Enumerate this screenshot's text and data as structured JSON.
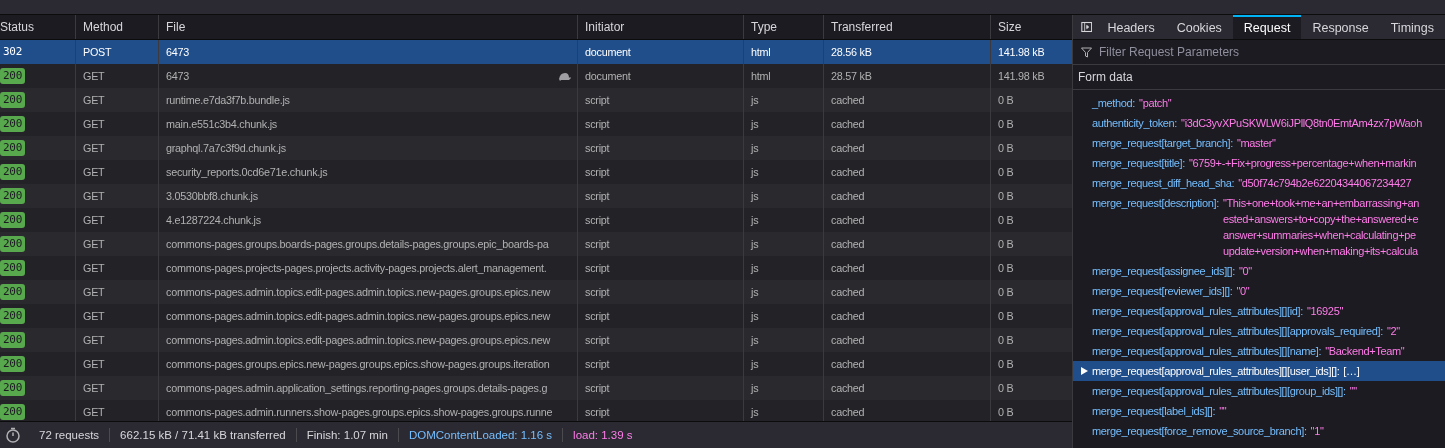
{
  "columns": [
    "Status",
    "Method",
    "File",
    "Initiator",
    "Type",
    "Transferred",
    "Size"
  ],
  "requests": [
    {
      "status": "302",
      "method": "POST",
      "file": "6473",
      "slow": false,
      "initiator": "document",
      "type": "html",
      "transferred": "28.56 kB",
      "size": "141.98 kB",
      "selected": true
    },
    {
      "status": "200",
      "method": "GET",
      "file": "6473",
      "slow": true,
      "initiator": "document",
      "type": "html",
      "transferred": "28.57 kB",
      "size": "141.98 kB",
      "selected": false
    },
    {
      "status": "200",
      "method": "GET",
      "file": "runtime.e7da3f7b.bundle.js",
      "slow": false,
      "initiator": "script",
      "type": "js",
      "transferred": "cached",
      "size": "0 B",
      "selected": false
    },
    {
      "status": "200",
      "method": "GET",
      "file": "main.e551c3b4.chunk.js",
      "slow": false,
      "initiator": "script",
      "type": "js",
      "transferred": "cached",
      "size": "0 B",
      "selected": false
    },
    {
      "status": "200",
      "method": "GET",
      "file": "graphql.7a7c3f9d.chunk.js",
      "slow": false,
      "initiator": "script",
      "type": "js",
      "transferred": "cached",
      "size": "0 B",
      "selected": false
    },
    {
      "status": "200",
      "method": "GET",
      "file": "security_reports.0cd6e71e.chunk.js",
      "slow": false,
      "initiator": "script",
      "type": "js",
      "transferred": "cached",
      "size": "0 B",
      "selected": false
    },
    {
      "status": "200",
      "method": "GET",
      "file": "3.0530bbf8.chunk.js",
      "slow": false,
      "initiator": "script",
      "type": "js",
      "transferred": "cached",
      "size": "0 B",
      "selected": false
    },
    {
      "status": "200",
      "method": "GET",
      "file": "4.e1287224.chunk.js",
      "slow": false,
      "initiator": "script",
      "type": "js",
      "transferred": "cached",
      "size": "0 B",
      "selected": false
    },
    {
      "status": "200",
      "method": "GET",
      "file": "commons-pages.groups.boards-pages.groups.details-pages.groups.epic_boards-pa",
      "slow": false,
      "initiator": "script",
      "type": "js",
      "transferred": "cached",
      "size": "0 B",
      "selected": false
    },
    {
      "status": "200",
      "method": "GET",
      "file": "commons-pages.projects-pages.projects.activity-pages.projects.alert_management.",
      "slow": false,
      "initiator": "script",
      "type": "js",
      "transferred": "cached",
      "size": "0 B",
      "selected": false
    },
    {
      "status": "200",
      "method": "GET",
      "file": "commons-pages.admin.topics.edit-pages.admin.topics.new-pages.groups.epics.new",
      "slow": false,
      "initiator": "script",
      "type": "js",
      "transferred": "cached",
      "size": "0 B",
      "selected": false
    },
    {
      "status": "200",
      "method": "GET",
      "file": "commons-pages.admin.topics.edit-pages.admin.topics.new-pages.groups.epics.new",
      "slow": false,
      "initiator": "script",
      "type": "js",
      "transferred": "cached",
      "size": "0 B",
      "selected": false
    },
    {
      "status": "200",
      "method": "GET",
      "file": "commons-pages.admin.topics.edit-pages.admin.topics.new-pages.groups.epics.new",
      "slow": false,
      "initiator": "script",
      "type": "js",
      "transferred": "cached",
      "size": "0 B",
      "selected": false
    },
    {
      "status": "200",
      "method": "GET",
      "file": "commons-pages.groups.epics.new-pages.groups.epics.show-pages.groups.iteration",
      "slow": false,
      "initiator": "script",
      "type": "js",
      "transferred": "cached",
      "size": "0 B",
      "selected": false
    },
    {
      "status": "200",
      "method": "GET",
      "file": "commons-pages.admin.application_settings.reporting-pages.groups.details-pages.g",
      "slow": false,
      "initiator": "script",
      "type": "js",
      "transferred": "cached",
      "size": "0 B",
      "selected": false
    },
    {
      "status": "200",
      "method": "GET",
      "file": "commons-pages.admin.runners.show-pages.groups.epics.show-pages.groups.runne",
      "slow": false,
      "initiator": "script",
      "type": "js",
      "transferred": "cached",
      "size": "0 B",
      "selected": false
    }
  ],
  "summary": {
    "requests": "72 requests",
    "transferred": "662.15 kB / 71.41 kB transferred",
    "finish": "Finish: 1.07 min",
    "dom_content_loaded": "DOMContentLoaded: 1.16 s",
    "load": "load: 1.39 s"
  },
  "detail_tabs": [
    {
      "label": "Headers",
      "selected": false
    },
    {
      "label": "Cookies",
      "selected": false
    },
    {
      "label": "Request",
      "selected": true
    },
    {
      "label": "Response",
      "selected": false
    },
    {
      "label": "Timings",
      "selected": false
    }
  ],
  "filter": {
    "placeholder": "Filter Request Parameters"
  },
  "section_title": "Form data",
  "params": [
    {
      "kind": "value",
      "key": "_method:",
      "value": [
        "\"patch\""
      ],
      "selected": false
    },
    {
      "kind": "value",
      "key": "authenticity_token:",
      "value": [
        "\"i3dC3yvXPuSKWLW6iJPllQ8tn0EmtAm4zx7pWaoh"
      ],
      "selected": false
    },
    {
      "kind": "value",
      "key": "merge_request[target_branch]:",
      "value": [
        "\"master\""
      ],
      "selected": false
    },
    {
      "kind": "value",
      "key": "merge_request[title]:",
      "value": [
        "\"6759+-+Fix+progress+percentage+when+markin"
      ],
      "selected": false
    },
    {
      "kind": "value",
      "key": "merge_request_diff_head_sha:",
      "value": [
        "\"d50f74c794b2e62204344067234427"
      ],
      "selected": false
    },
    {
      "kind": "value",
      "key": "merge_request[description]:",
      "value": [
        "\"This+one+took+me+an+embarrassing+an",
        "ested+answers+to+copy+the+answered+e",
        "answer+summaries+when+calculating+pe",
        "update+version+when+making+its+calcula"
      ],
      "selected": false
    },
    {
      "kind": "value",
      "key": "merge_request[assignee_ids][]:",
      "value": [
        "\"0\""
      ],
      "selected": false
    },
    {
      "kind": "value",
      "key": "merge_request[reviewer_ids][]:",
      "value": [
        "\"0\""
      ],
      "selected": false
    },
    {
      "kind": "value",
      "key": "merge_request[approval_rules_attributes][][id]:",
      "value": [
        "\"16925\""
      ],
      "selected": false
    },
    {
      "kind": "value",
      "key": "merge_request[approval_rules_attributes][][approvals_required]:",
      "value": [
        "\"2\""
      ],
      "selected": false
    },
    {
      "kind": "value",
      "key": "merge_request[approval_rules_attributes][][name]:",
      "value": [
        "\"Backend+Team\""
      ],
      "selected": false
    },
    {
      "kind": "array",
      "key": "merge_request[approval_rules_attributes][][user_ids][]:",
      "value": [
        "[…]"
      ],
      "selected": true
    },
    {
      "kind": "value",
      "key": "merge_request[approval_rules_attributes][][group_ids][]:",
      "value": [
        "\"\""
      ],
      "selected": false
    },
    {
      "kind": "value",
      "key": "merge_request[label_ids][]:",
      "value": [
        "\"\""
      ],
      "selected": false
    },
    {
      "kind": "value",
      "key": "merge_request[force_remove_source_branch]:",
      "value": [
        "\"1\""
      ],
      "selected": false
    }
  ]
}
